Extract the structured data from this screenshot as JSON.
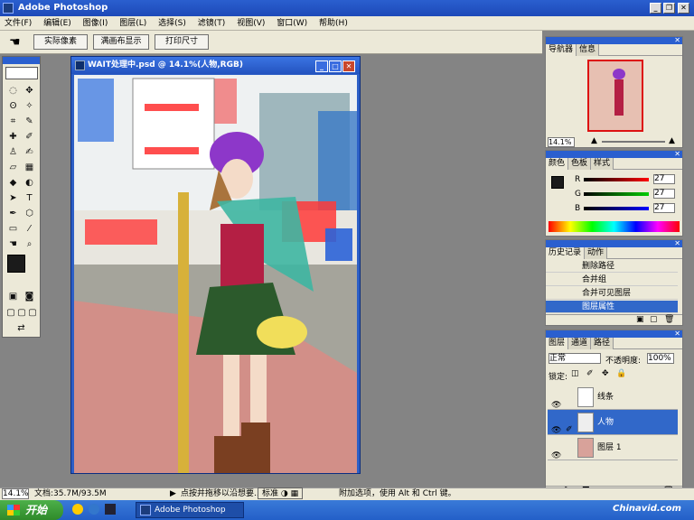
{
  "app": {
    "title": "Adobe Photoshop"
  },
  "menu": [
    "文件(F)",
    "编辑(E)",
    "图像(I)",
    "图层(L)",
    "选择(S)",
    "滤镜(T)",
    "视图(V)",
    "窗口(W)",
    "帮助(H)"
  ],
  "options": {
    "btn_actual": "实际像素",
    "btn_fit": "满画布显示",
    "btn_print": "打印尺寸"
  },
  "document": {
    "title": "WAIT处理中.psd @ 14.1%(人物,RGB)"
  },
  "navigator": {
    "tab1": "导航器",
    "tab2": "信息",
    "zoom": "14.1%"
  },
  "color": {
    "tab1": "颜色",
    "tab2": "色板",
    "tab3": "样式",
    "r_label": "R",
    "g_label": "G",
    "b_label": "B",
    "r_value": "27",
    "g_value": "27",
    "b_value": "27"
  },
  "history": {
    "tab1": "历史记录",
    "tab2": "动作",
    "items": [
      "删除路径",
      "合并组",
      "合并可见图层",
      "图层属性"
    ]
  },
  "layers": {
    "tab1": "图层",
    "tab2": "通道",
    "tab3": "路径",
    "blend_mode": "正常",
    "opacity_label": "不透明度:",
    "opacity_value": "100%",
    "lock_label": "锁定:",
    "items": [
      "线条",
      "人物",
      "图层 1"
    ]
  },
  "status": {
    "zoom": "14.1%",
    "doc_size": "文档:35.7M/93.5M",
    "hint": "点按并拖移以沿想要...",
    "hint_tail": "附加选项，使用 Alt 和 Ctrl 键。",
    "ime_label": "标准"
  },
  "taskbar": {
    "start": "开始",
    "task": "Adobe Photoshop",
    "watermark": "Chinavid.com"
  },
  "colors": {
    "titlebar": "#2a5fcf",
    "selection": "#3168c9"
  }
}
